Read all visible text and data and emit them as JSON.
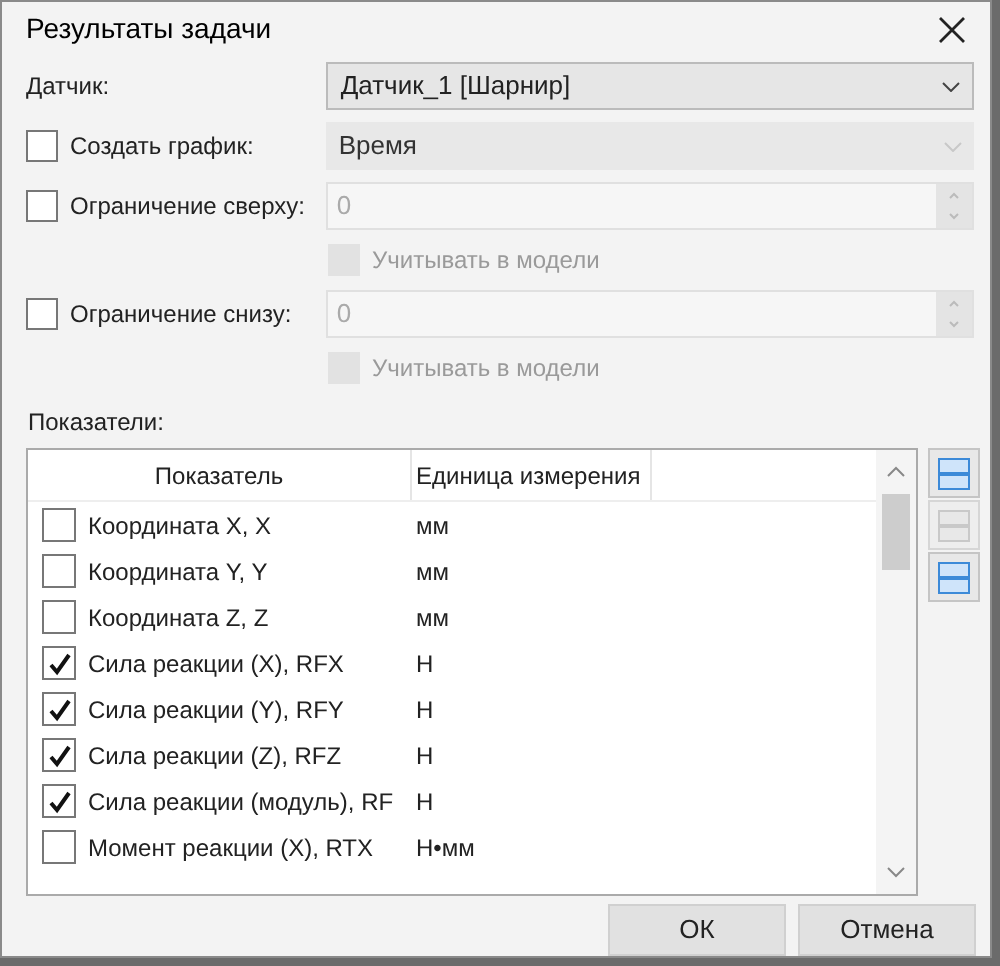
{
  "window": {
    "title": "Результаты задачи"
  },
  "sensor": {
    "label": "Датчик:",
    "value": "Датчик_1 [Шарнир]",
    "disabled": false
  },
  "options": [
    {
      "kind": "combo",
      "label": "Создать график:",
      "checked": false,
      "value": "Время",
      "disabled": true
    },
    {
      "kind": "spin",
      "label": "Ограничение сверху:",
      "checked": false,
      "value": "0",
      "disabled": true,
      "sub": {
        "label": "Учитывать в модели",
        "checked": false,
        "disabled": true
      }
    },
    {
      "kind": "spin",
      "label": "Ограничение снизу:",
      "checked": false,
      "value": "0",
      "disabled": true,
      "sub": {
        "label": "Учитывать в модели",
        "checked": false,
        "disabled": true
      }
    }
  ],
  "indicators": {
    "label": "Показатели:",
    "columns": [
      "Показатель",
      "Единица измерения"
    ],
    "rows": [
      {
        "name": "Координата X, X",
        "unit": "мм",
        "checked": false
      },
      {
        "name": "Координата Y, Y",
        "unit": "мм",
        "checked": false
      },
      {
        "name": "Координата Z, Z",
        "unit": "мм",
        "checked": false
      },
      {
        "name": "Сила реакции (X), RFX",
        "unit": "Н",
        "checked": true
      },
      {
        "name": "Сила реакции (Y), RFY",
        "unit": "Н",
        "checked": true
      },
      {
        "name": "Сила реакции (Z), RFZ",
        "unit": "Н",
        "checked": true
      },
      {
        "name": "Сила реакции (модуль), RF",
        "unit": "Н",
        "checked": true
      },
      {
        "name": "Момент реакции (X), RTX",
        "unit": "Н•мм",
        "checked": false
      }
    ],
    "tools": [
      {
        "disabled": false
      },
      {
        "disabled": true
      },
      {
        "disabled": false
      }
    ]
  },
  "buttons": [
    "ОК",
    "Отмена"
  ]
}
